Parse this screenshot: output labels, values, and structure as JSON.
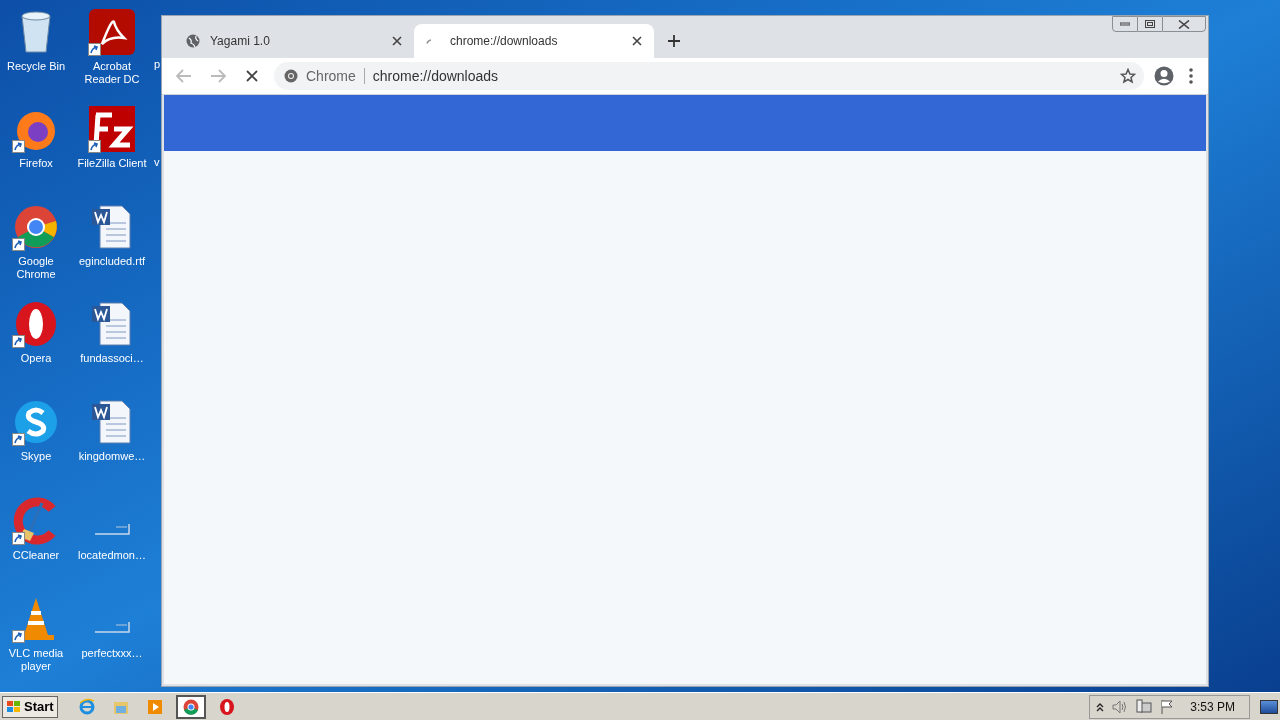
{
  "desktop_icons": [
    {
      "label": "Recycle Bin",
      "kind": "recycle",
      "shortcut": false
    },
    {
      "label": "Firefox",
      "kind": "firefox",
      "shortcut": true
    },
    {
      "label": "Google Chrome",
      "kind": "chrome",
      "shortcut": true
    },
    {
      "label": "Opera",
      "kind": "opera",
      "shortcut": true
    },
    {
      "label": "Skype",
      "kind": "skype",
      "shortcut": true
    },
    {
      "label": "CCleaner",
      "kind": "ccleaner",
      "shortcut": true
    },
    {
      "label": "VLC media player",
      "kind": "vlc",
      "shortcut": true
    },
    {
      "label": "Acrobat Reader DC",
      "kind": "acrobat",
      "shortcut": true
    },
    {
      "label": "FileZilla Client",
      "kind": "filezilla",
      "shortcut": true
    },
    {
      "label": "egincluded.rtf",
      "kind": "word",
      "shortcut": false
    },
    {
      "label": "fundassoci…",
      "kind": "word",
      "shortcut": false
    },
    {
      "label": "kingdomwe…",
      "kind": "word",
      "shortcut": false
    },
    {
      "label": "locatedmon…",
      "kind": "blank",
      "shortcut": false
    },
    {
      "label": "perfectxxx…",
      "kind": "blank",
      "shortcut": false
    },
    {
      "label": "p",
      "kind": "hidden"
    },
    {
      "label": "v",
      "kind": "hidden"
    }
  ],
  "browser": {
    "tabs": [
      {
        "title": "Yagami 1.0",
        "kind": "globe",
        "selected": false
      },
      {
        "title": "chrome://downloads",
        "kind": "loading",
        "selected": true
      }
    ],
    "address_bar": {
      "site_label": "Chrome",
      "url": "chrome://downloads"
    },
    "loading": true
  },
  "taskbar": {
    "start": "Start",
    "apps": [
      {
        "kind": "ie",
        "active": false
      },
      {
        "kind": "folder",
        "active": false
      },
      {
        "kind": "media",
        "active": false
      },
      {
        "kind": "chrome",
        "active": true
      },
      {
        "kind": "opera",
        "active": false
      }
    ],
    "clock": "3:53 PM"
  }
}
